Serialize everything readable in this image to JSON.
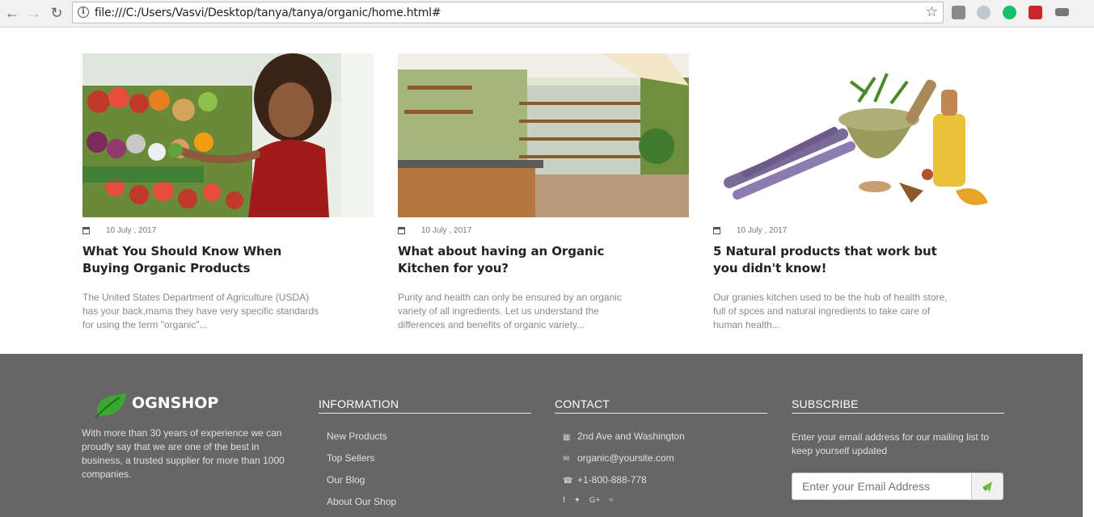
{
  "browser": {
    "url": "file:///C:/Users/Vasvi/Desktop/tanya/tanya/organic/home.html#"
  },
  "posts": [
    {
      "date": "10 July , 2017",
      "title": "What You Should Know When Buying Organic Products",
      "excerpt": "The United States Department of Agriculture (USDA) has your back,mama they have very specific standards for using the term \"organic\"..."
    },
    {
      "date": "10 July , 2017",
      "title": "What about having an Organic Kitchen for you?",
      "excerpt": "Purity and health can only be ensured by an organic variety of all ingredients. Let us understand the differences and benefits of organic variety..."
    },
    {
      "date": "10 July , 2017",
      "title": "5 Natural products that work but you didn't know!",
      "excerpt": "Our granies kitchen used to be the hub of health store, full of spces and natural ingredients to take care of human health..."
    }
  ],
  "footer": {
    "brand": "OGNSHOP",
    "about": "With more than 30 years of experience we can proudly say that we are one of the best in business, a trusted supplier for more than 1000 companies.",
    "information": {
      "heading": "INFORMATION",
      "links": [
        "New Products",
        "Top Sellers",
        "Our Blog",
        "About Our Shop"
      ]
    },
    "contact": {
      "heading": "CONTACT",
      "address": "2nd Ave and Washington",
      "email": "organic@yoursite.com",
      "phone": "+1-800-888-778"
    },
    "subscribe": {
      "heading": "SUBSCRIBE",
      "text": "Enter your email address for our mailing list to keep yourself updated",
      "placeholder": "Enter your Email Address"
    }
  },
  "colors": {
    "footer_bg": "#666666",
    "brand_green": "#3aa833"
  }
}
